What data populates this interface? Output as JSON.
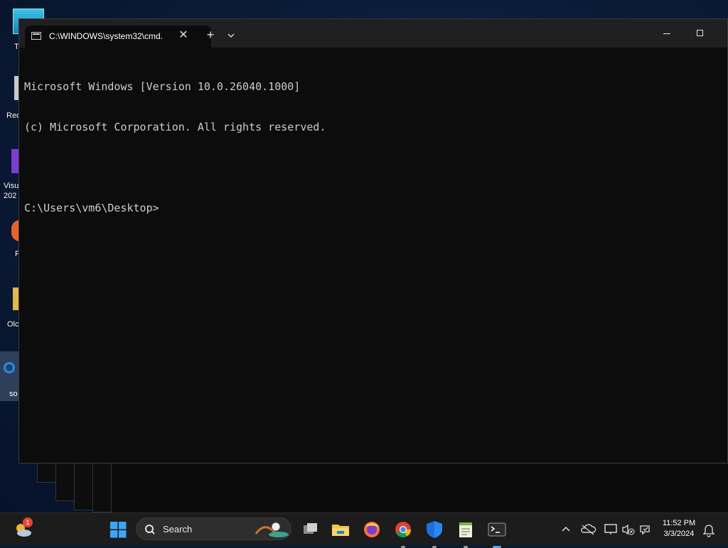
{
  "desktop": {
    "icons": [
      {
        "label": "T"
      },
      {
        "label": "Rec"
      },
      {
        "label": "Visu"
      },
      {
        "label": "202"
      },
      {
        "label": "F"
      },
      {
        "label": "Olc"
      },
      {
        "label": "so"
      }
    ]
  },
  "window": {
    "tab_title": "C:\\WINDOWS\\system32\\cmd.",
    "tab_close": "✕",
    "new_tab": "+",
    "console_lines": [
      "Microsoft Windows [Version 10.0.26040.1000]",
      "(c) Microsoft Corporation. All rights reserved.",
      "",
      "C:\\Users\\vm6\\Desktop>"
    ]
  },
  "taskbar": {
    "search_placeholder": "Search",
    "weather_badge": "1",
    "clock_time": "11:52 PM",
    "clock_date": "3/3/2024",
    "icons": [
      "weather-icon",
      "start-icon",
      "search-icon",
      "task-view-icon",
      "file-explorer-icon",
      "firefox-icon",
      "chrome-icon",
      "defender-icon",
      "notepad-icon",
      "terminal-icon",
      "chevron-up-icon",
      "onedrive-icon",
      "network-icon",
      "volume-icon",
      "wifi-icon",
      "bell-icon"
    ]
  },
  "colors": {
    "console_bg": "#0c0c0c",
    "console_text": "#cccccc",
    "titlebar": "#202020",
    "taskbar": "#1c1c1c"
  }
}
